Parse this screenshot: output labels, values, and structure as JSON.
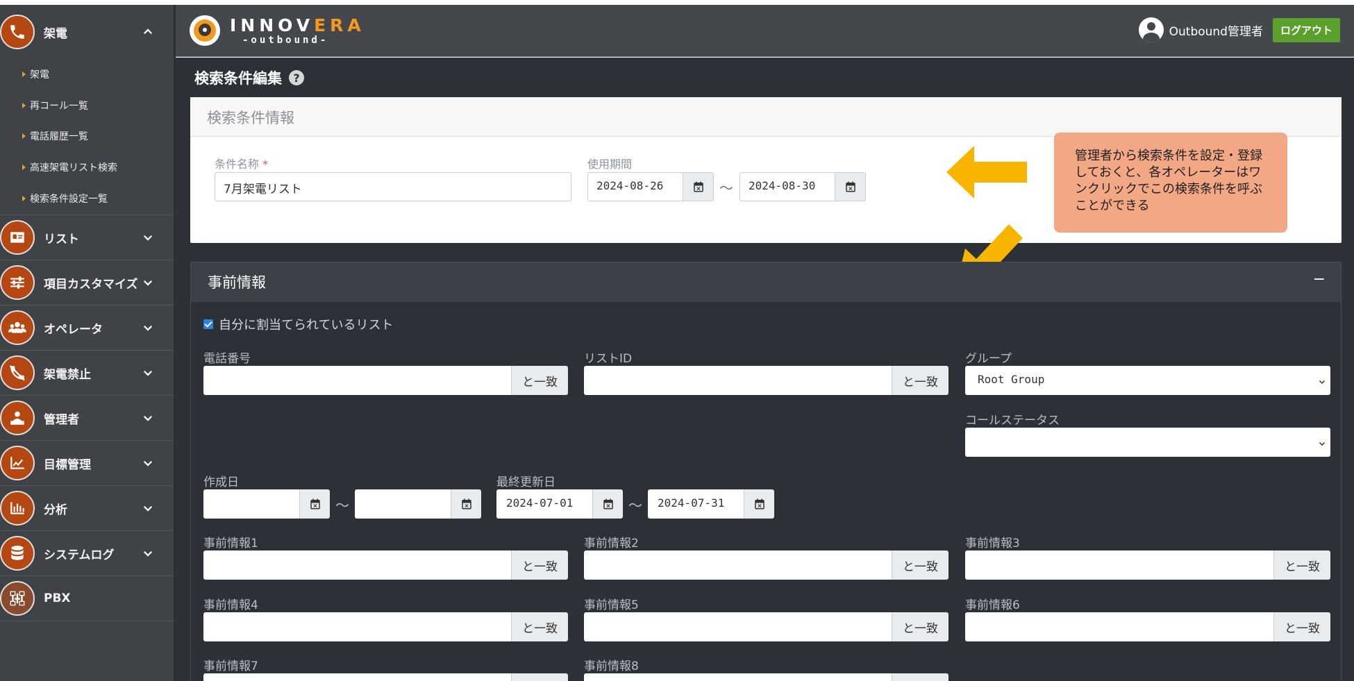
{
  "sidebar": {
    "groups": [
      {
        "label": "架電",
        "icon": "phone-icon",
        "expanded": true,
        "items": [
          {
            "label": "架電"
          },
          {
            "label": "再コール一覧"
          },
          {
            "label": "電話履歴一覧"
          },
          {
            "label": "高速架電リスト検索"
          },
          {
            "label": "検索条件設定一覧"
          }
        ]
      },
      {
        "label": "リスト",
        "icon": "contact-card-icon"
      },
      {
        "label": "項目カスタマイズ",
        "icon": "sliders-icon"
      },
      {
        "label": "オペレータ",
        "icon": "users-icon"
      },
      {
        "label": "架電禁止",
        "icon": "phone-slash-icon"
      },
      {
        "label": "管理者",
        "icon": "admin-icon"
      },
      {
        "label": "目標管理",
        "icon": "line-chart-icon"
      },
      {
        "label": "分析",
        "icon": "bar-chart-icon"
      },
      {
        "label": "システムログ",
        "icon": "database-icon"
      },
      {
        "label": "PBX",
        "icon": "network-icon"
      }
    ]
  },
  "header": {
    "logo_main_a": "INNOV",
    "logo_main_b": "ERA",
    "logo_sub": "-outbound-",
    "user_name": "Outbound管理者",
    "logout_label": "ログアウト"
  },
  "page": {
    "title": "検索条件編集",
    "help": "?"
  },
  "condition_card": {
    "title": "検索条件情報",
    "name_label": "条件名称",
    "required_mark": "*",
    "name_value": "7月架電リスト",
    "period_label": "使用期間",
    "period_from": "2024-08-26",
    "period_to": "2024-08-30",
    "tilde": "〜"
  },
  "callout": {
    "text": "管理者から検索条件を設定・登録しておくと、各オペレーターはワンクリックでこの検索条件を呼ぶことができる"
  },
  "pre_info_card": {
    "title": "事前情報",
    "collapse": "−",
    "assigned_checkbox": "自分に割当てられているリスト",
    "phone_label": "電話番号",
    "list_id_label": "リストID",
    "group_label": "グループ",
    "group_value": "Root Group",
    "call_status_label": "コールステータス",
    "call_status_value": "",
    "created_label": "作成日",
    "created_from": "",
    "created_to": "",
    "updated_label": "最終更新日",
    "updated_from": "2024-07-01",
    "updated_to": "2024-07-31",
    "match_label": "と一致",
    "tilde": "〜",
    "info_labels": [
      "事前情報1",
      "事前情報2",
      "事前情報3",
      "事前情報4",
      "事前情報5",
      "事前情報6",
      "事前情報7",
      "事前情報8"
    ]
  },
  "colors": {
    "accent_orange": "#b54712",
    "logout_green": "#5aa02c",
    "callout_bg": "#f2a884",
    "arrow_yellow": "#f7b500"
  }
}
